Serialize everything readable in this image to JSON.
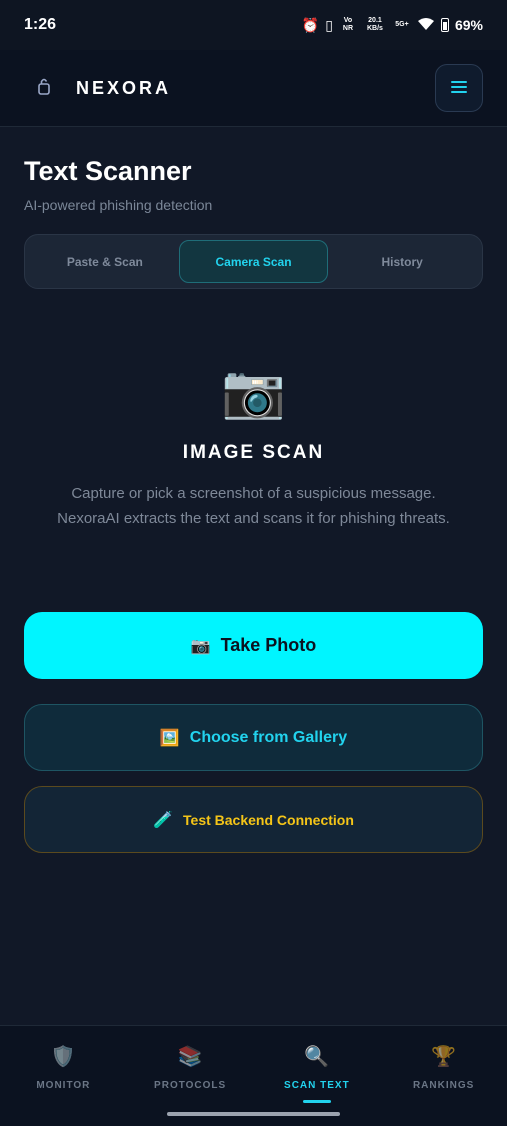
{
  "status_bar": {
    "time": "1:26",
    "icons": [
      "alarm-icon",
      "vibrate-icon",
      "volte-icon",
      "data-speed-icon",
      "signal-icon",
      "wifi-icon",
      "battery-icon"
    ],
    "volte_text": "Vo NR",
    "data_speed": "20.1 KB/s",
    "network": "5G+",
    "battery": "69%"
  },
  "header": {
    "brand": "NEXORA",
    "logo_icon": "lock-icon",
    "menu_icon": "hamburger-icon"
  },
  "page": {
    "title": "Text Scanner",
    "subtitle": "AI-powered phishing detection"
  },
  "tabs": [
    {
      "label": "Paste & Scan",
      "active": false
    },
    {
      "label": "Camera Scan",
      "active": true
    },
    {
      "label": "History",
      "active": false
    }
  ],
  "scan": {
    "icon": "camera-icon",
    "heading": "IMAGE SCAN",
    "description": "Capture or pick a screenshot of a suspicious message. NexoraAI extracts the text and scans it for phishing threats."
  },
  "buttons": {
    "take_photo": "Take Photo",
    "choose_gallery": "Choose from Gallery",
    "test_backend": "Test Backend Connection"
  },
  "bottom_nav": [
    {
      "label": "MONITOR",
      "icon": "shield-icon",
      "active": false
    },
    {
      "label": "PROTOCOLS",
      "icon": "books-icon",
      "active": false
    },
    {
      "label": "SCAN TEXT",
      "icon": "magnifier-icon",
      "active": true
    },
    {
      "label": "RANKINGS",
      "icon": "trophy-icon",
      "active": false
    }
  ],
  "colors": {
    "background": "#111827",
    "accent": "#22d3ee",
    "primary_button": "#00f5ff",
    "warning_text": "#f5c518"
  }
}
